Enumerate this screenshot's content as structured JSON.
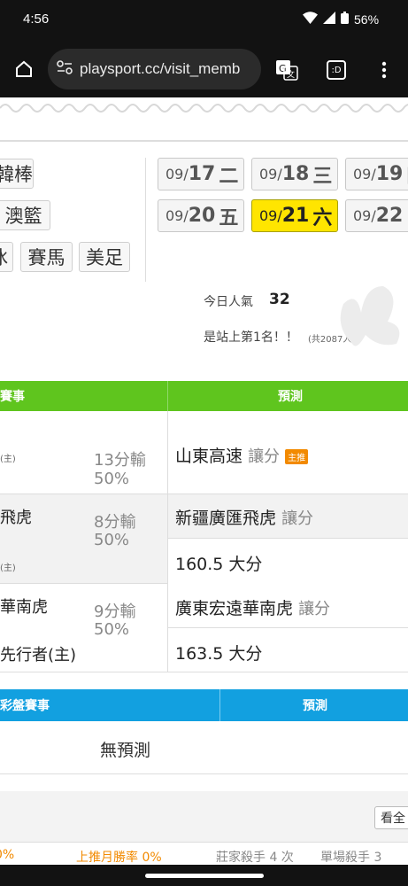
{
  "status_bar": {
    "time": "4:56",
    "battery": "56%"
  },
  "browser": {
    "url": "playsport.cc/visit_memb",
    "tab_label": ":D"
  },
  "sports": [
    "韓棒",
    "澳籃",
    "冰",
    "賽馬",
    "美足"
  ],
  "dates": [
    {
      "md": "09/",
      "day": "17",
      "wd": "二"
    },
    {
      "md": "09/",
      "day": "18",
      "wd": "三"
    },
    {
      "md": "09/",
      "day": "19",
      "wd": "四"
    },
    {
      "md": "09/",
      "day": "20",
      "wd": "五"
    },
    {
      "md": "09/",
      "day": "21",
      "wd": "六"
    },
    {
      "md": "09/",
      "day": "22",
      "wd": "日"
    }
  ],
  "popularity": {
    "label": "今日人氣",
    "value": "32",
    "rank_text": "是站上第1名！！",
    "total": "(共2087人)"
  },
  "table1": {
    "col_event": "賽事",
    "col_pred": "預測",
    "rows": [
      {
        "team_a": "",
        "team_b": "(主)",
        "odds": "13分輸",
        "pct": "50%",
        "preds": [
          {
            "team": "山東高速",
            "type": "讓分",
            "badge": "主推"
          }
        ]
      },
      {
        "team_a": "飛虎",
        "team_b": "(主)",
        "odds": "8分輸",
        "pct": "50%",
        "preds": [
          {
            "team": "新疆廣匯飛虎",
            "type": "讓分"
          },
          {
            "team": "160.5 大分",
            "type": ""
          }
        ]
      },
      {
        "team_a": "華南虎",
        "team_b": "先行者(主)",
        "odds": "9分輸",
        "pct": "50%",
        "preds": [
          {
            "team": "廣東宏遠華南虎",
            "type": "讓分"
          },
          {
            "team": "163.5 大分",
            "type": ""
          }
        ]
      }
    ]
  },
  "table2": {
    "col_event": "彩盤賽事",
    "col_pred": "預測",
    "empty_text": "無預測"
  },
  "footer": {
    "view_all": "看全",
    "stats": [
      "0%",
      "上推月勝率 0%",
      "莊家殺手 4 次",
      "單場殺手 3"
    ]
  }
}
